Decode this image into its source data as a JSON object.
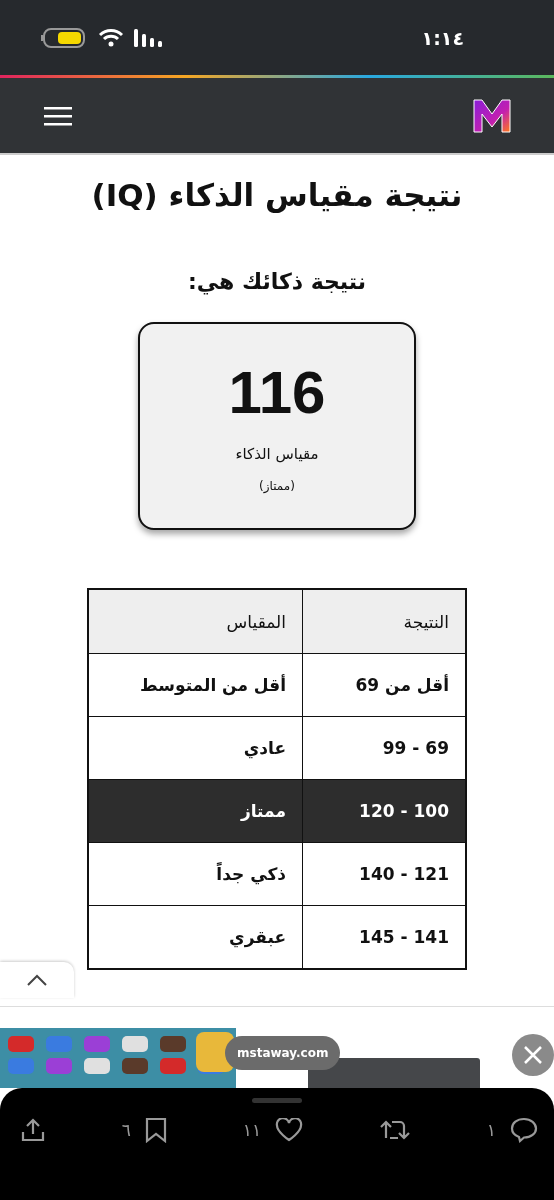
{
  "status_bar": {
    "time": "١:١٤"
  },
  "title": "نتيجة مقياس الذكاء (IQ)",
  "subtitle": "نتيجة ذكائك هي:",
  "result": {
    "score": "116",
    "label": "مقياس الذكاء",
    "category": "(ممتاز)"
  },
  "table": {
    "columns": [
      "النتيجة",
      "المقياس"
    ],
    "rows": [
      {
        "range": "أقل من 69",
        "rating": "أقل من المتوسط",
        "selected": false
      },
      {
        "range": "69 - 99",
        "rating": "عادي",
        "selected": false
      },
      {
        "range": "100 - 120",
        "rating": "ممتاز",
        "selected": true
      },
      {
        "range": "121 - 140",
        "rating": "ذكي جداً",
        "selected": false
      },
      {
        "range": "141 - 145",
        "rating": "عبقري",
        "selected": false
      }
    ]
  },
  "ad": {
    "site": "mstaway.com"
  },
  "actions": [
    {
      "kind": "reply",
      "count": "١"
    },
    {
      "kind": "repost"
    },
    {
      "kind": "like",
      "count": "١١"
    },
    {
      "kind": "bookmark",
      "count": "٦"
    },
    {
      "kind": "share"
    }
  ]
}
